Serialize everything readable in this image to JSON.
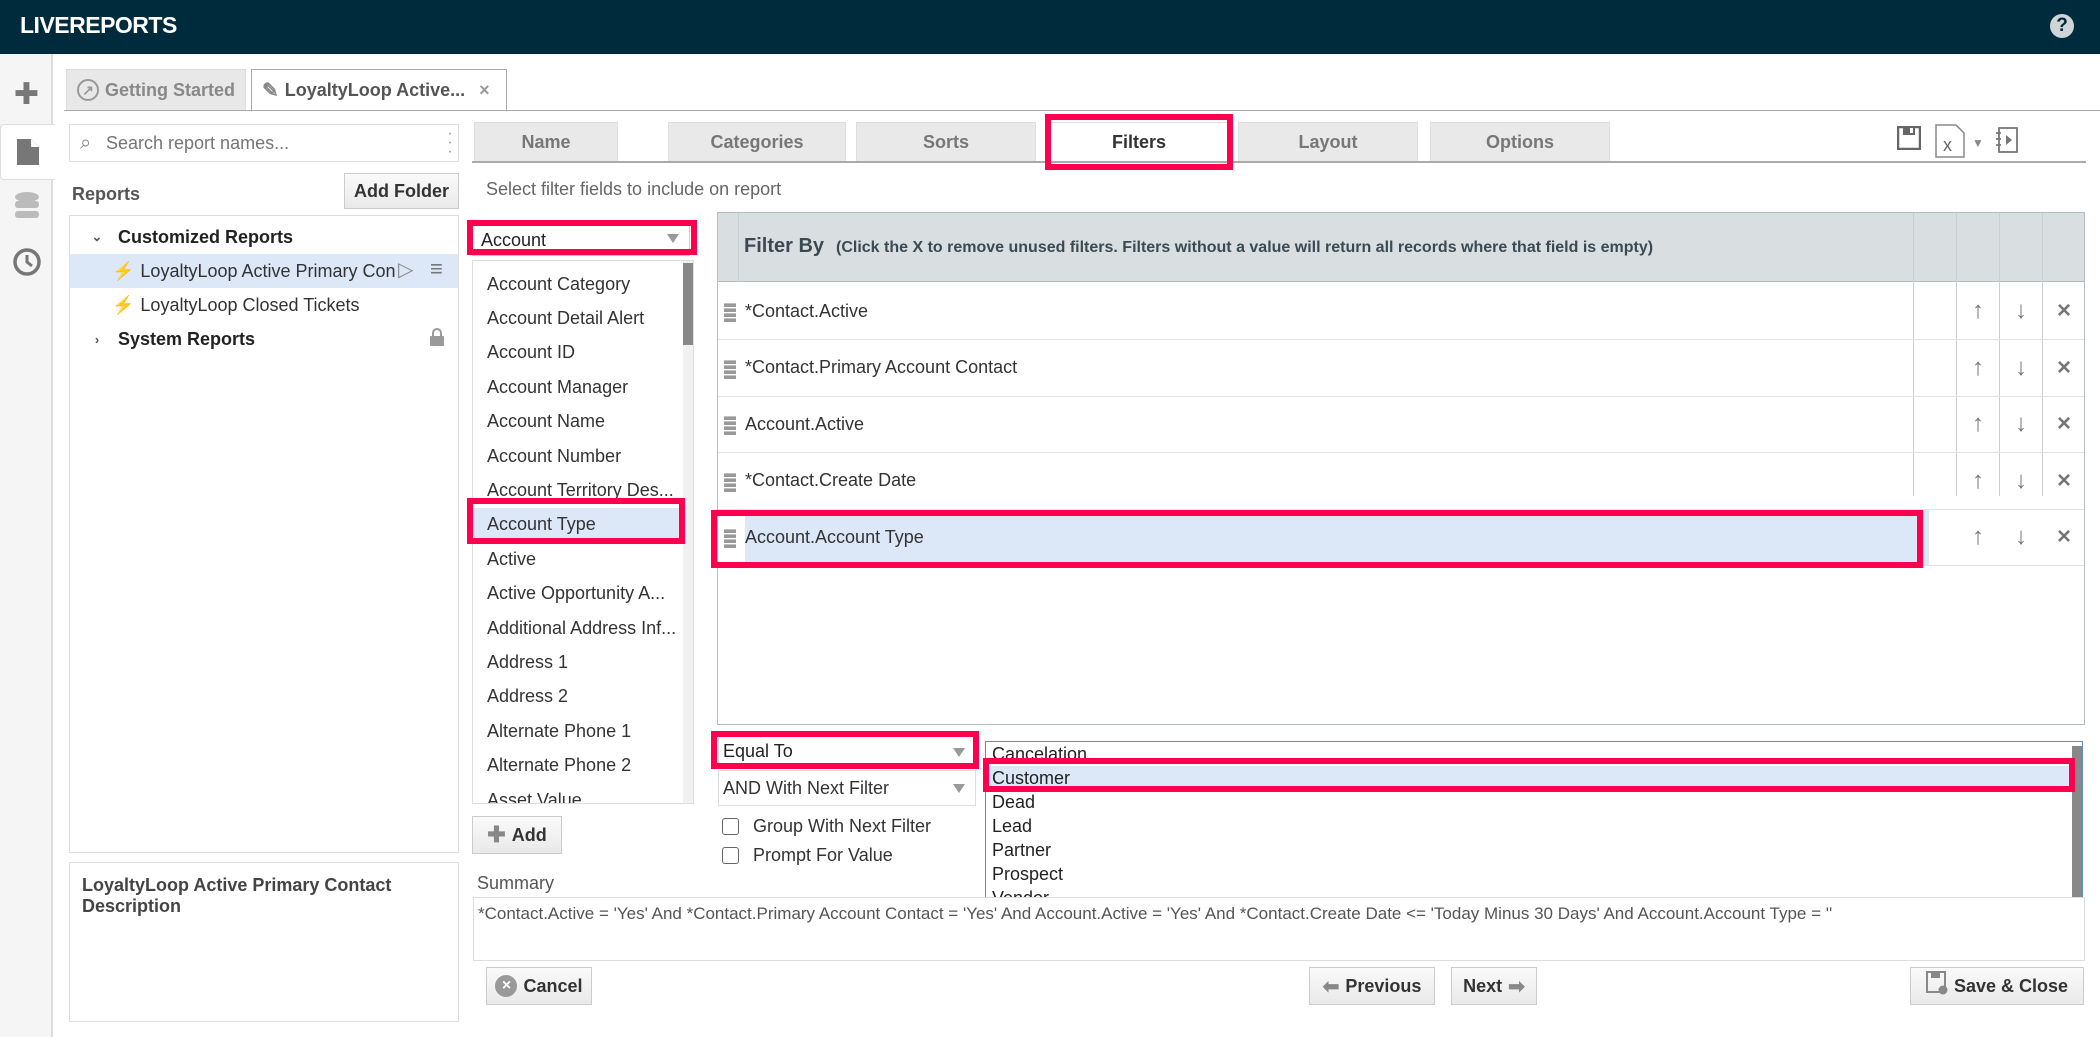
{
  "header": {
    "app_title": "LIVEREPORTS",
    "help_icon": "help-icon"
  },
  "rail": {
    "items": [
      {
        "icon": "plus-icon",
        "label": "New"
      },
      {
        "icon": "document-icon",
        "label": "Reports",
        "active": true
      },
      {
        "icon": "database-icon",
        "label": "Data"
      },
      {
        "icon": "clock-icon",
        "label": "History"
      }
    ]
  },
  "doc_tabs": [
    {
      "label": "Getting Started",
      "icon": "arrow-circle-icon",
      "active": false
    },
    {
      "label": "LoyaltyLoop Active...",
      "icon": "pencil-icon",
      "active": true,
      "close": "×"
    }
  ],
  "left_panel": {
    "search_placeholder": "Search report names...",
    "reports_label": "Reports",
    "add_folder_label": "Add Folder",
    "tree": [
      {
        "type": "folder",
        "label": "Customized Reports",
        "expanded": true
      },
      {
        "type": "report",
        "label": "LoyaltyLoop Active Primary Con",
        "selected": true
      },
      {
        "type": "report",
        "label": "LoyaltyLoop Closed Tickets"
      },
      {
        "type": "folder",
        "label": "System Reports",
        "expanded": false,
        "locked": true
      }
    ],
    "description_title": "LoyaltyLoop Active Primary Contact Description"
  },
  "wizard": {
    "tabs": [
      {
        "label": "Name"
      },
      {
        "label": "Categories"
      },
      {
        "label": "Sorts"
      },
      {
        "label": "Filters",
        "active": true
      },
      {
        "label": "Layout"
      },
      {
        "label": "Options"
      }
    ],
    "instruction": "Select filter fields to include on report",
    "table_select": "Account",
    "fields": [
      "Account Category",
      "Account Detail Alert",
      "Account ID",
      "Account Manager",
      "Account Name",
      "Account Number",
      "Account Territory Des...",
      "Account Type",
      "Active",
      "Active Opportunity A...",
      "Additional Address Inf...",
      "Address 1",
      "Address 2",
      "Alternate Phone 1",
      "Alternate Phone 2",
      "Asset Value"
    ],
    "selected_field": "Account Type",
    "add_label": "Add",
    "grid": {
      "title": "Filter By",
      "note": "(Click the X to remove unused filters. Filters without a value will return all records where that field is empty)",
      "rows": [
        {
          "name": "*Contact.Active"
        },
        {
          "name": "*Contact.Primary Account Contact"
        },
        {
          "name": "Account.Active"
        },
        {
          "name": "*Contact.Create Date"
        },
        {
          "name": "Account.Account Type",
          "selected": true
        }
      ],
      "up": "↑",
      "down": "↓",
      "remove": "×"
    },
    "operator": "Equal To",
    "join": "AND With Next Filter",
    "group_label": "Group With Next Filter",
    "prompt_label": "Prompt For Value",
    "values": [
      "Cancelation",
      "Customer",
      "Dead",
      "Lead",
      "Partner",
      "Prospect",
      "Vendor"
    ],
    "selected_value": "Customer",
    "summary_label": "Summary",
    "summary_text": "*Contact.Active = 'Yes' And *Contact.Primary Account Contact = 'Yes' And Account.Active = 'Yes' And *Contact.Create Date <= 'Today Minus 30 Days' And Account.Account Type = ''",
    "cancel_label": "Cancel",
    "previous_label": "Previous",
    "next_label": "Next",
    "save_close_label": "Save & Close"
  },
  "colors": {
    "header_bg": "#002b3c",
    "highlight": "#ff004f",
    "selection": "#dce8f8"
  }
}
